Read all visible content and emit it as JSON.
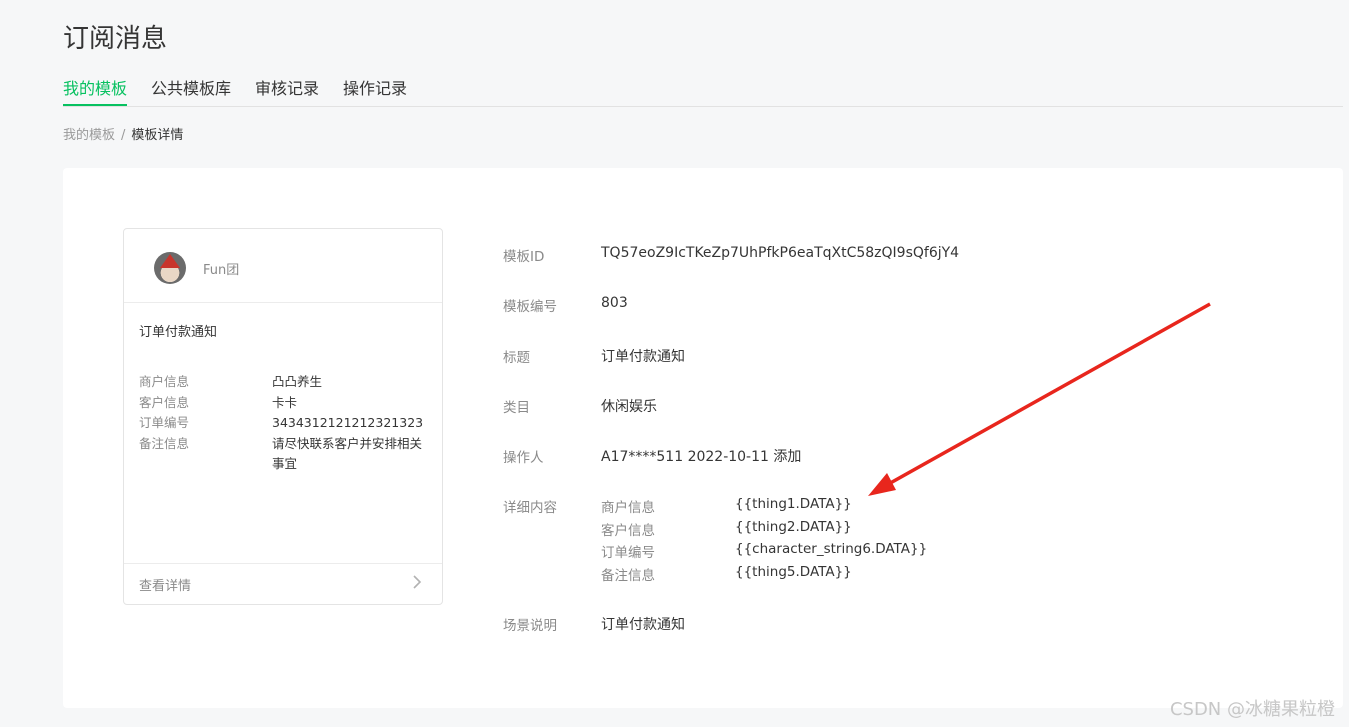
{
  "page": {
    "title": "订阅消息"
  },
  "tabs": [
    {
      "label": "我的模板",
      "active": true
    },
    {
      "label": "公共模板库",
      "active": false
    },
    {
      "label": "审核记录",
      "active": false
    },
    {
      "label": "操作记录",
      "active": false
    }
  ],
  "breadcrumb": {
    "parent": "我的模板",
    "separator": "/",
    "current": "模板详情"
  },
  "preview": {
    "account_name": "Fun团",
    "title": "订单付款通知",
    "fields": [
      {
        "key": "商户信息",
        "value": "凸凸养生"
      },
      {
        "key": "客户信息",
        "value": "卡卡"
      },
      {
        "key": "订单编号",
        "value": "3434312121212321323"
      },
      {
        "key": "备注信息",
        "value": "请尽快联系客户并安排相关事宜"
      }
    ],
    "footer_label": "查看详情"
  },
  "details": {
    "template_id": {
      "label": "模板ID",
      "value": "TQ57eoZ9IcTKeZp7UhPfkP6eaTqXtC58zQI9sQf6jY4"
    },
    "template_number": {
      "label": "模板编号",
      "value": "803"
    },
    "title": {
      "label": "标题",
      "value": "订单付款通知"
    },
    "category": {
      "label": "类目",
      "value": "休闲娱乐"
    },
    "operator": {
      "label": "操作人",
      "value": "A17****511 2022-10-11 添加"
    },
    "content": {
      "label": "详细内容",
      "items": [
        {
          "key": "商户信息",
          "value": "{{thing1.DATA}}"
        },
        {
          "key": "客户信息",
          "value": "{{thing2.DATA}}"
        },
        {
          "key": "订单编号",
          "value": "{{character_string6.DATA}}"
        },
        {
          "key": "备注信息",
          "value": "{{thing5.DATA}}"
        }
      ]
    },
    "scene": {
      "label": "场景说明",
      "value": "订单付款通知"
    }
  },
  "watermark": "CSDN @冰糖果粒橙",
  "colors": {
    "accent": "#07c160",
    "arrow": "#e8261d"
  }
}
